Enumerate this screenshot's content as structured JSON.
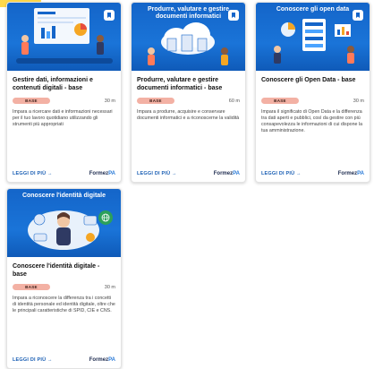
{
  "cards": [
    {
      "banner_title": "",
      "title": "Gestire dati, informazioni e contenuti digitali - base",
      "level": "BASE",
      "duration": "30 m",
      "description": "Impara a ricercare dati e informazioni necessari per il tuo lavoro quotidiano utilizzando gli strumenti più appropriati",
      "read_more": "LEGGI DI PIÙ →",
      "brand": "FormezPA",
      "banner_color": "#1465c9"
    },
    {
      "banner_title": "Produrre, valutare e gestire documenti informatici",
      "title": "Produrre, valutare e gestire documenti informatici - base",
      "level": "BASE",
      "duration": "60 m",
      "description": "Impara a produrre, acquisire e conservare documenti informatici e a riconoscerne la validità",
      "read_more": "LEGGI DI PIÙ →",
      "brand": "FormezPA",
      "banner_color": "#1465c9"
    },
    {
      "banner_title": "Conoscere gli open data",
      "title": "Conoscere gli Open Data - base",
      "level": "BASE",
      "duration": "30 m",
      "description": "Impara il significato di Open Data e la differenza tra dati aperti e pubblici, così da gestire con più consapevolezza le informazioni di cui dispone la tua amministrazione.",
      "read_more": "LEGGI DI PIÙ →",
      "brand": "FormezPA",
      "banner_color": "#1465c9"
    },
    {
      "banner_title": "Conoscere l'identità digitale",
      "title": "Conoscere l'identità digitale - base",
      "level": "BASE",
      "duration": "30 m",
      "description": "Impara a riconoscere la differenza tra i concetti di identità personale ed identità digitale, oltre che le principali caratteristiche di SPID, CIE e CNS.",
      "read_more": "LEGGI DI PIÙ →",
      "brand": "FormezPA",
      "banner_color": "#1465c9"
    }
  ]
}
